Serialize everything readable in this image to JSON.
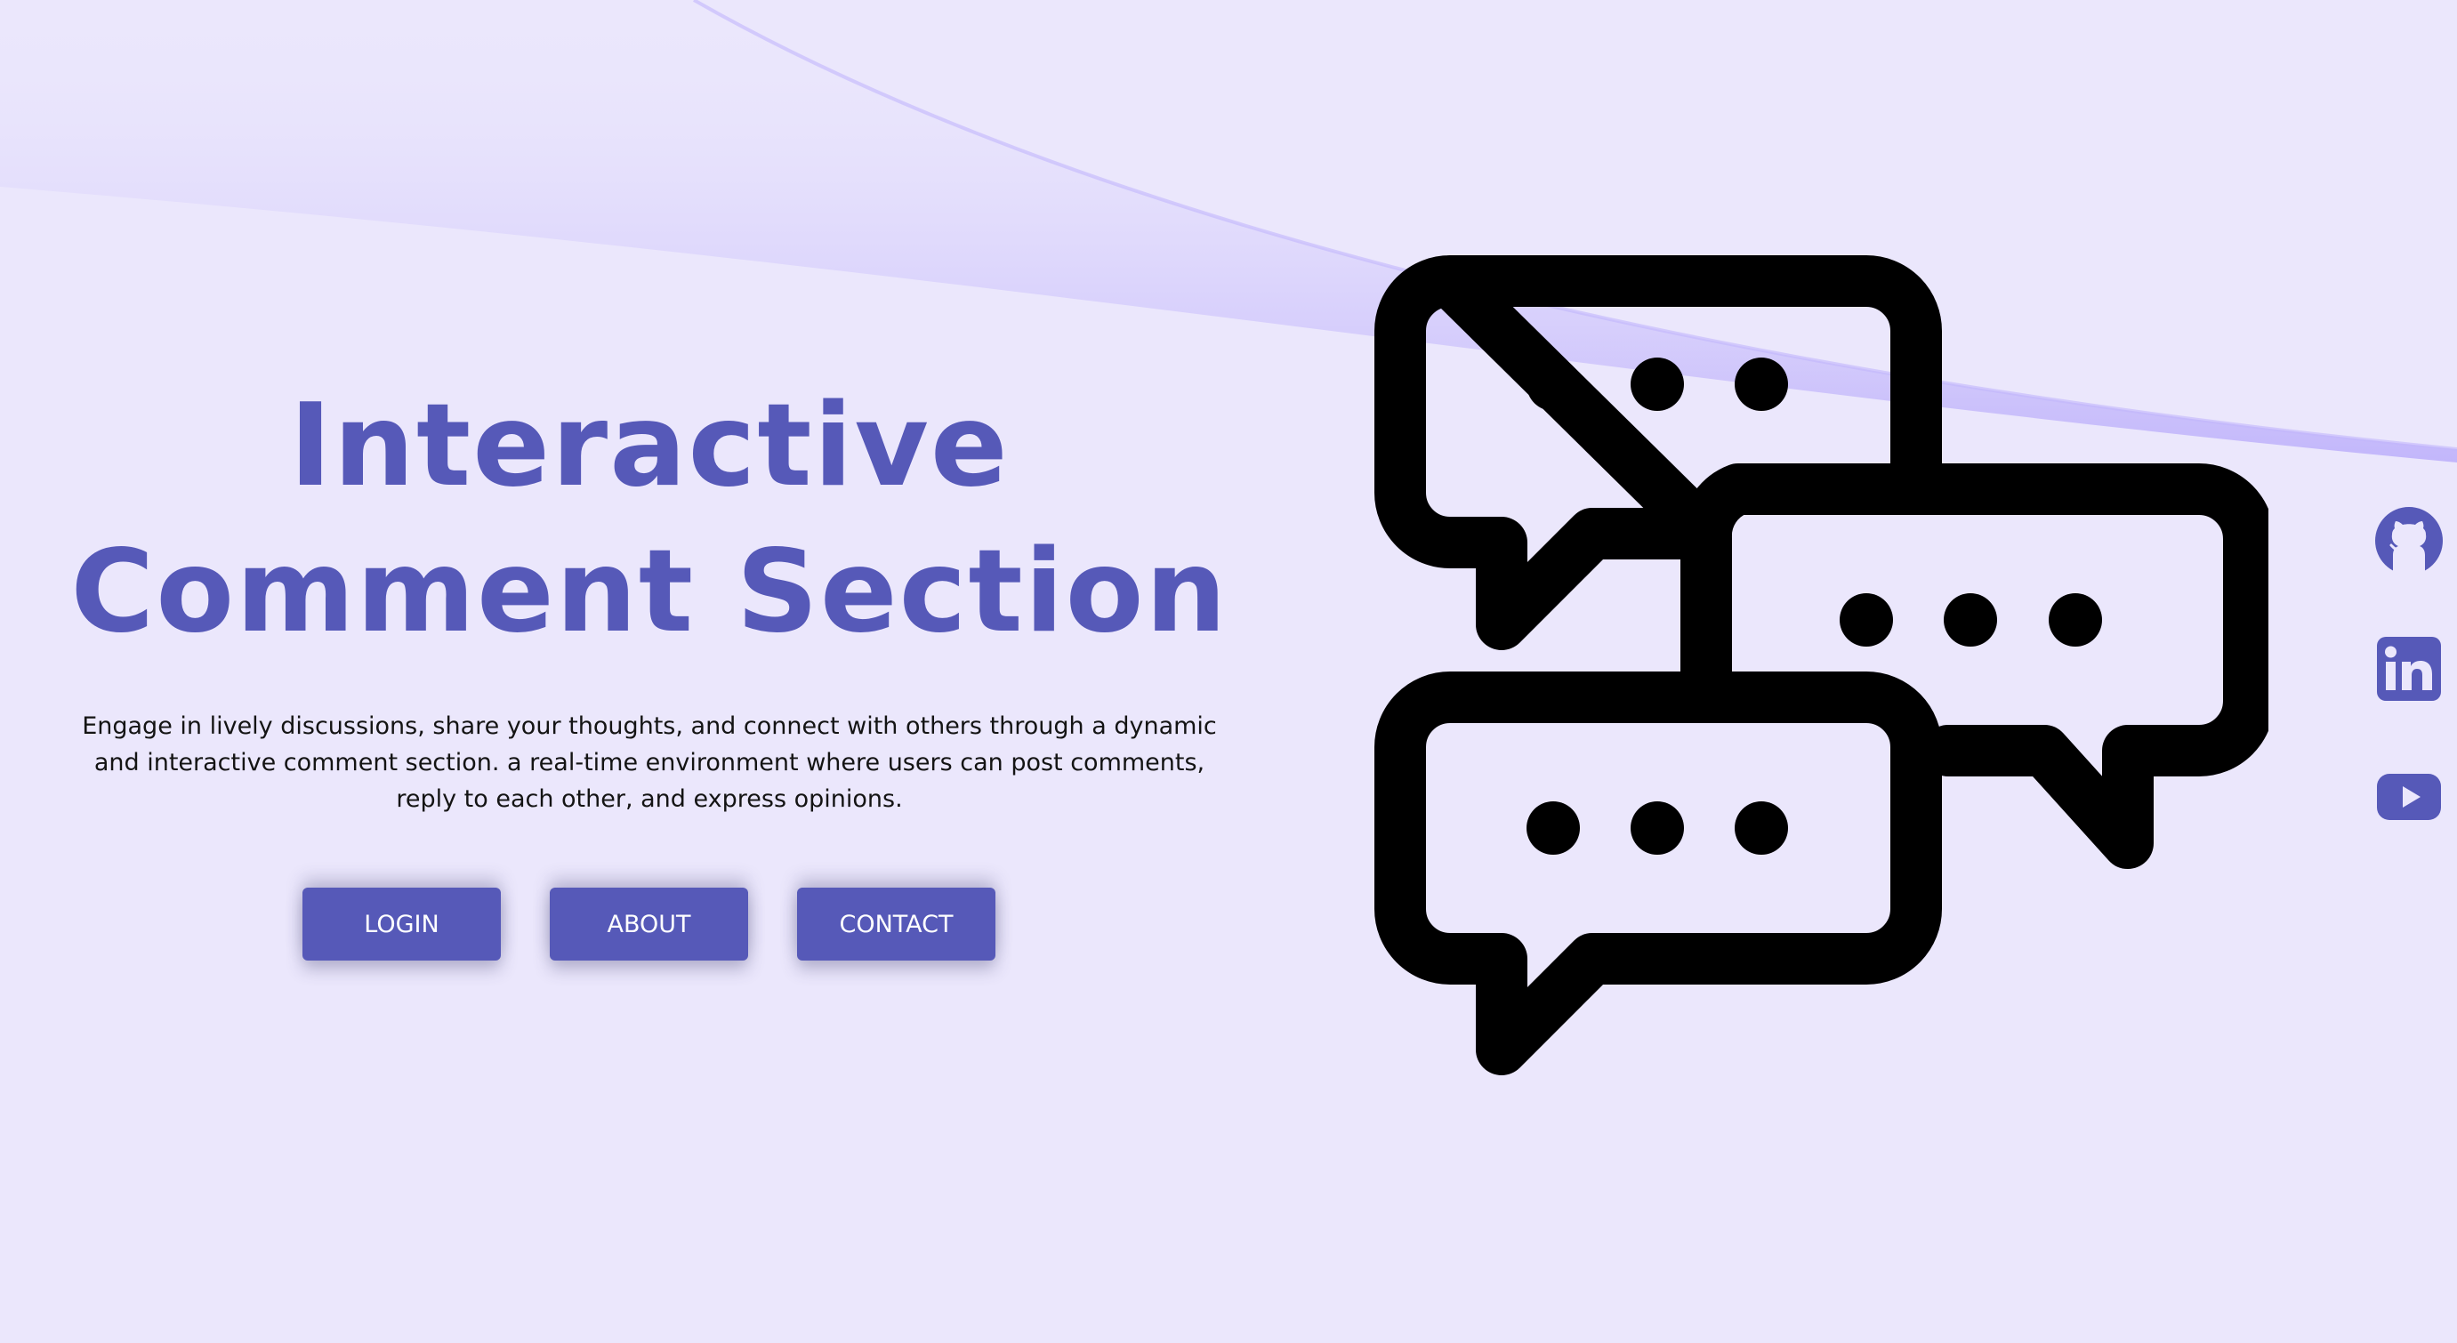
{
  "hero": {
    "title_line1": "Interactive",
    "title_line2": "Comment Section",
    "description": "Engage in lively discussions, share your thoughts, and connect with others through a dynamic and interactive comment section. a real-time environment where users can post comments, reply to each other, and express opinions."
  },
  "buttons": {
    "login": "LOGIN",
    "about": "ABOUT",
    "contact": "CONTACT"
  },
  "social": [
    {
      "icon": "github-icon"
    },
    {
      "icon": "linkedin-icon"
    },
    {
      "icon": "youtube-icon"
    }
  ],
  "illustration": {
    "icon": "chat-bubbles-icon"
  },
  "colors": {
    "background": "#ebe7fc",
    "accent": "#5659b8",
    "swoosh": "#c2b6fb",
    "text": "#141414",
    "icon_stroke": "#000000"
  }
}
